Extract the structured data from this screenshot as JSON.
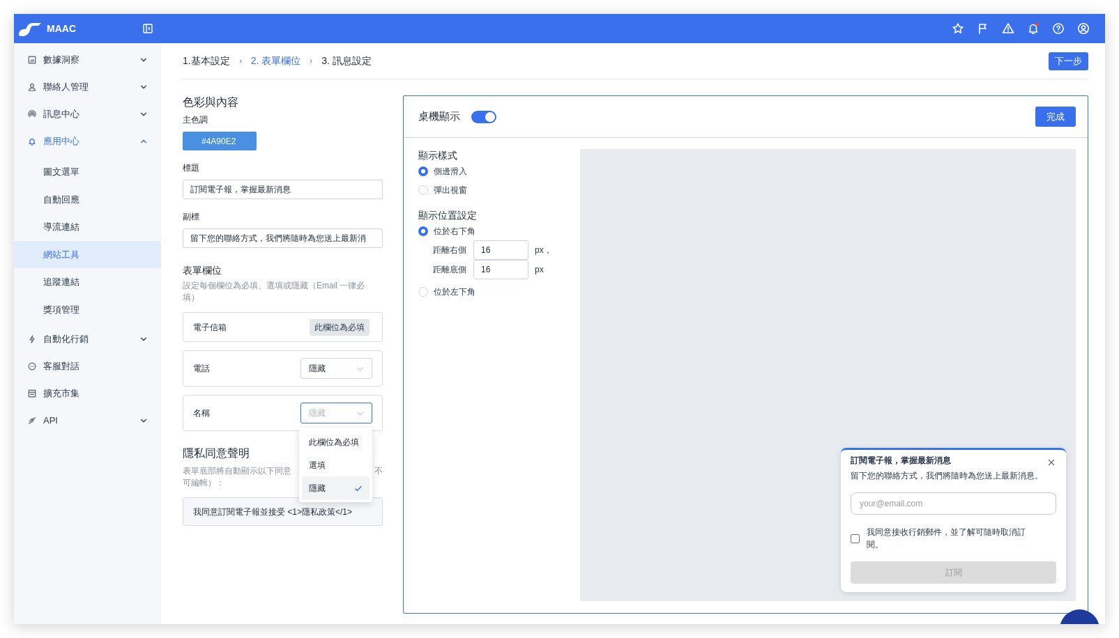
{
  "app": {
    "name": "MAAC"
  },
  "notifications": {
    "unread": true
  },
  "sidebar": {
    "items": [
      {
        "label": "數據洞察",
        "expanded": false,
        "selected": false
      },
      {
        "label": "聯絡人管理",
        "expanded": false,
        "selected": false
      },
      {
        "label": "訊息中心",
        "expanded": false,
        "selected": false
      },
      {
        "label": "應用中心",
        "expanded": true,
        "selected": false,
        "children": [
          {
            "label": "圖文選單",
            "selected": false
          },
          {
            "label": "自動回應",
            "selected": false
          },
          {
            "label": "導流連結",
            "selected": false
          },
          {
            "label": "網站工具",
            "selected": true
          },
          {
            "label": "追蹤連結",
            "selected": false
          },
          {
            "label": "獎項管理",
            "selected": false
          }
        ]
      },
      {
        "label": "自動化行銷",
        "expanded": false,
        "selected": false
      },
      {
        "label": "客服對話",
        "selected": false
      },
      {
        "label": "擴充市集",
        "selected": false
      },
      {
        "label": "API",
        "expanded": false,
        "selected": false
      }
    ]
  },
  "steps": [
    {
      "label": "1.基本設定",
      "selected": false
    },
    {
      "label": "2. 表單欄位",
      "selected": true
    },
    {
      "label": "3. 訊息設定",
      "selected": false
    }
  ],
  "next_button": "下一步",
  "colors": {
    "heading": "色彩與內容",
    "label": "主色調",
    "value": "#4A90E2",
    "color": "#4a90e2"
  },
  "title_field": {
    "label": "標題",
    "value": "訂閱電子報，掌握最新消息"
  },
  "subtitle_field": {
    "label": "副標",
    "value": "留下您的聯絡方式，我們將隨時為您送上最新消"
  },
  "form_fields": {
    "heading": "表單欄位",
    "description": "設定每個欄位為必填、選填或隱藏（Email 一律必填）",
    "fields": [
      {
        "label": "電子信箱",
        "kind": "fixed",
        "value": "此欄位為必填"
      },
      {
        "label": "電話",
        "kind": "select",
        "value": "隱藏",
        "open": false
      },
      {
        "label": "名稱",
        "kind": "select",
        "value": "隱藏",
        "open": true,
        "options": [
          {
            "label": "此欄位為必填",
            "selected": false
          },
          {
            "label": "選填",
            "selected": false
          },
          {
            "label": "隱藏",
            "selected": true
          }
        ]
      }
    ]
  },
  "privacy": {
    "heading": "隱私同意聲明",
    "description_parts": [
      "表單底部將自動顯示以下同意",
      "不",
      "可編輯）："
    ],
    "consent_text": "我同意訂閱電子報並接受 <1>隱私政策</1>"
  },
  "desktop": {
    "label": "桌機顯示",
    "on": true,
    "done_button": "完成",
    "display_style": {
      "heading": "顯示樣式",
      "options": [
        {
          "label": "側邊滑入",
          "selected": true
        },
        {
          "label": "彈出視窗",
          "selected": false
        }
      ]
    },
    "position": {
      "heading": "顯示位置設定",
      "options": [
        {
          "label": "位於右下角",
          "selected": true
        },
        {
          "label": "位於左下角",
          "selected": false
        }
      ],
      "offsets": [
        {
          "label": "距離右側",
          "value": "16",
          "unit": "px，"
        },
        {
          "label": "距離底側",
          "value": "16",
          "unit": "px"
        }
      ]
    },
    "preview": {
      "title": "訂閱電子報，掌握最新消息",
      "subtitle": "留下您的聯絡方式，我們將隨時為您送上最新消息。",
      "email_placeholder": "your@email.com",
      "consent_label": "我同意接收行銷郵件，並了解可隨時取消訂閱。",
      "consent_checked": false,
      "subscribe_button": "訂閱",
      "subscribe_disabled": true
    }
  }
}
